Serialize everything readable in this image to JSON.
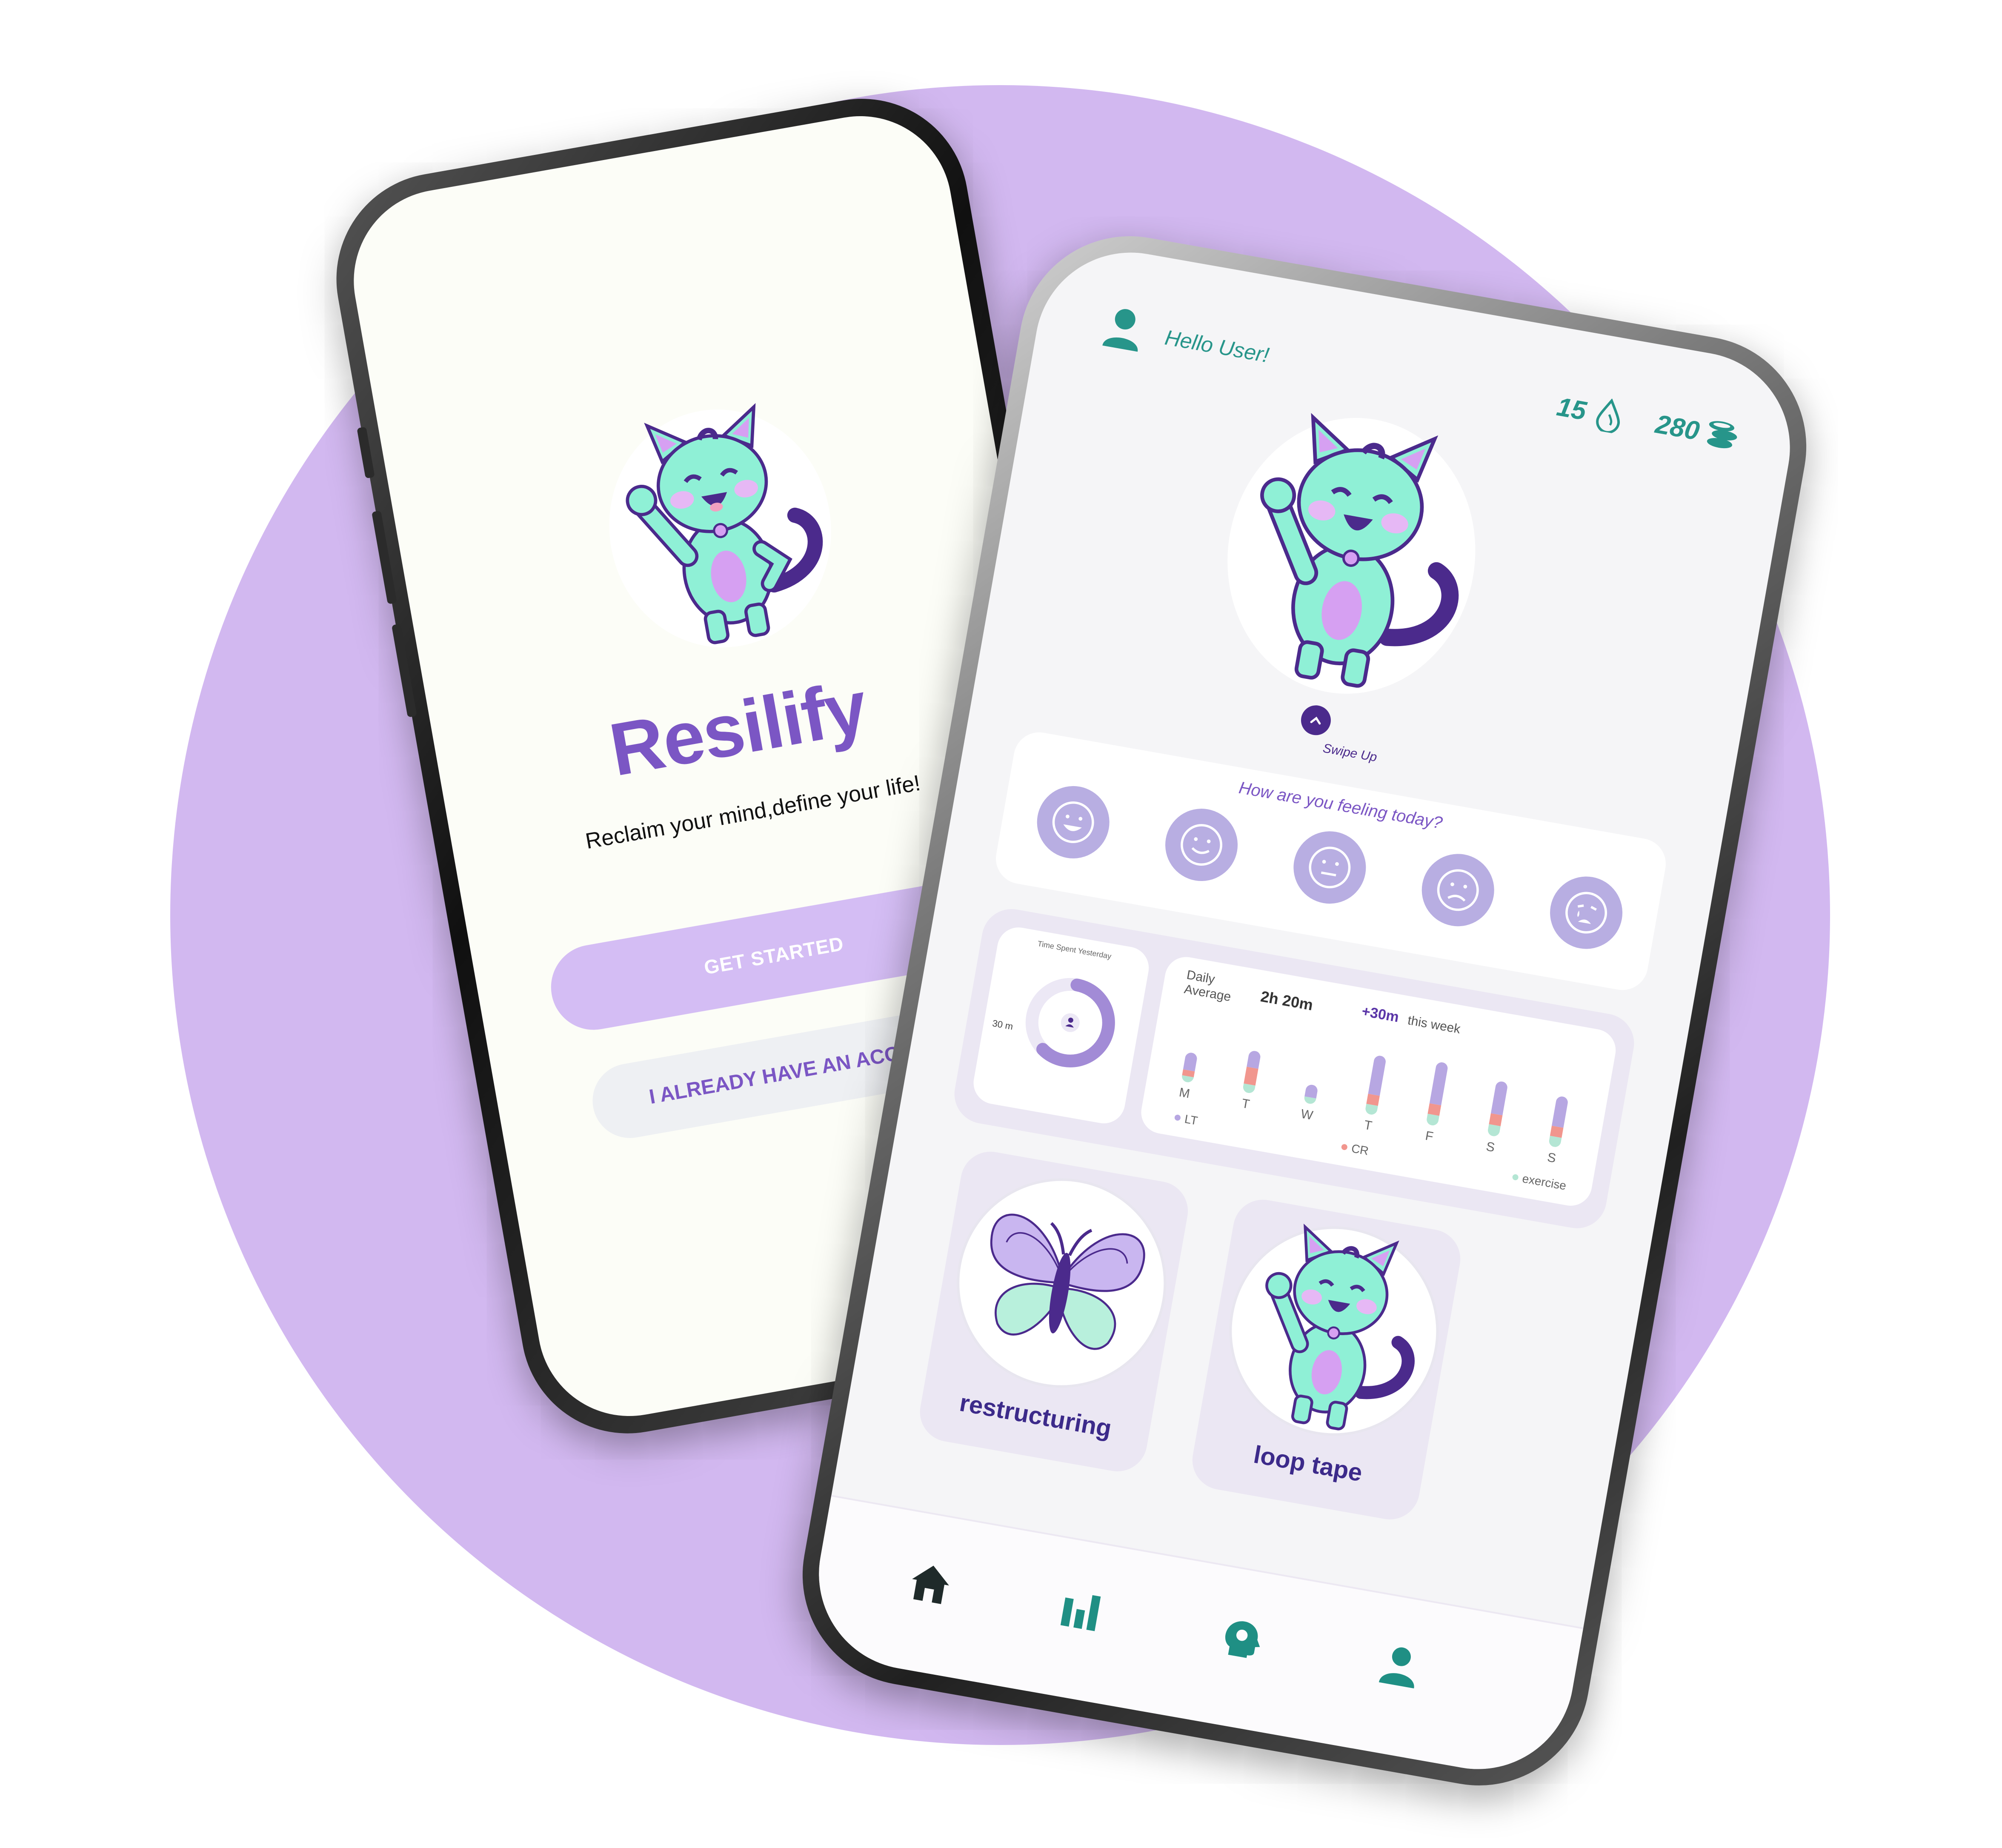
{
  "colors": {
    "background_circle": "#d2b8f0",
    "brand_purple": "#7b56c4",
    "teal": "#27958a",
    "mint": "#8ff0d6",
    "dark_purple": "#4b2a8c"
  },
  "welcome": {
    "app_name": "Resilify",
    "tagline": "Reclaim your mind,define your life!",
    "get_started_label": "GET STARTED",
    "have_account_label": "I ALREADY HAVE AN ACCOUNT",
    "mascot_icon": "cat-waving-icon"
  },
  "dashboard": {
    "header": {
      "greeting": "Hello User!",
      "streak_count": "15",
      "streak_icon": "drop-icon",
      "coins_count": "280",
      "coins_icon": "coins-icon"
    },
    "hero": {
      "mascot_icon": "cat-waving-icon",
      "swipe_label": "Swipe Up"
    },
    "mood": {
      "question": "How are you feeling today?",
      "options": [
        "very-happy-face-icon",
        "happy-face-icon",
        "neutral-face-icon",
        "sad-face-icon",
        "crying-face-icon"
      ]
    },
    "time_spent": {
      "title": "Time Spent Yesterday",
      "value_label": "30 m",
      "progress_fraction": 0.6
    },
    "weekly": {
      "daily_average_label": "Daily Average",
      "daily_average_value": "2h 20m",
      "change_value": "+30m",
      "change_label": "this week",
      "days": [
        "M",
        "T",
        "W",
        "T",
        "F",
        "S",
        "S"
      ],
      "legend": [
        "LT",
        "CR",
        "exercise"
      ]
    },
    "activities": [
      {
        "title": "restructuring",
        "icon": "butterfly-icon"
      },
      {
        "title": "loop tape",
        "icon": "cat-waving-icon"
      }
    ],
    "nav": [
      "home-icon",
      "stats-icon",
      "mind-icon",
      "profile-icon"
    ]
  }
}
